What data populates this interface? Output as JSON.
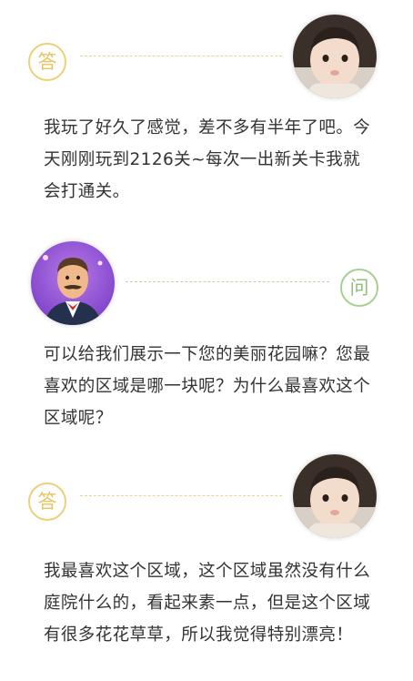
{
  "colors": {
    "answer_accent": "#efcf7a",
    "question_accent": "#a8cf93",
    "text": "#333333"
  },
  "entries": [
    {
      "kind": "answer",
      "badge": "答",
      "avatar_icon": "baby-photo-avatar",
      "text": "我玩了好久了感觉，差不多有半年了吧。今天刚刚玩到2126关~每次一出新关卡我就会打通关。"
    },
    {
      "kind": "question",
      "badge": "问",
      "avatar_icon": "butler-austin-avatar",
      "text": "可以给我们展示一下您的美丽花园嘛？您最喜欢的区域是哪一块呢？为什么最喜欢这个区域呢？"
    },
    {
      "kind": "answer",
      "badge": "答",
      "avatar_icon": "baby-photo-avatar",
      "text": "我最喜欢这个区域，这个区域虽然没有什么庭院什么的，看起来素一点，但是这个区域有很多花花草草，所以我觉得特别漂亮！"
    }
  ]
}
